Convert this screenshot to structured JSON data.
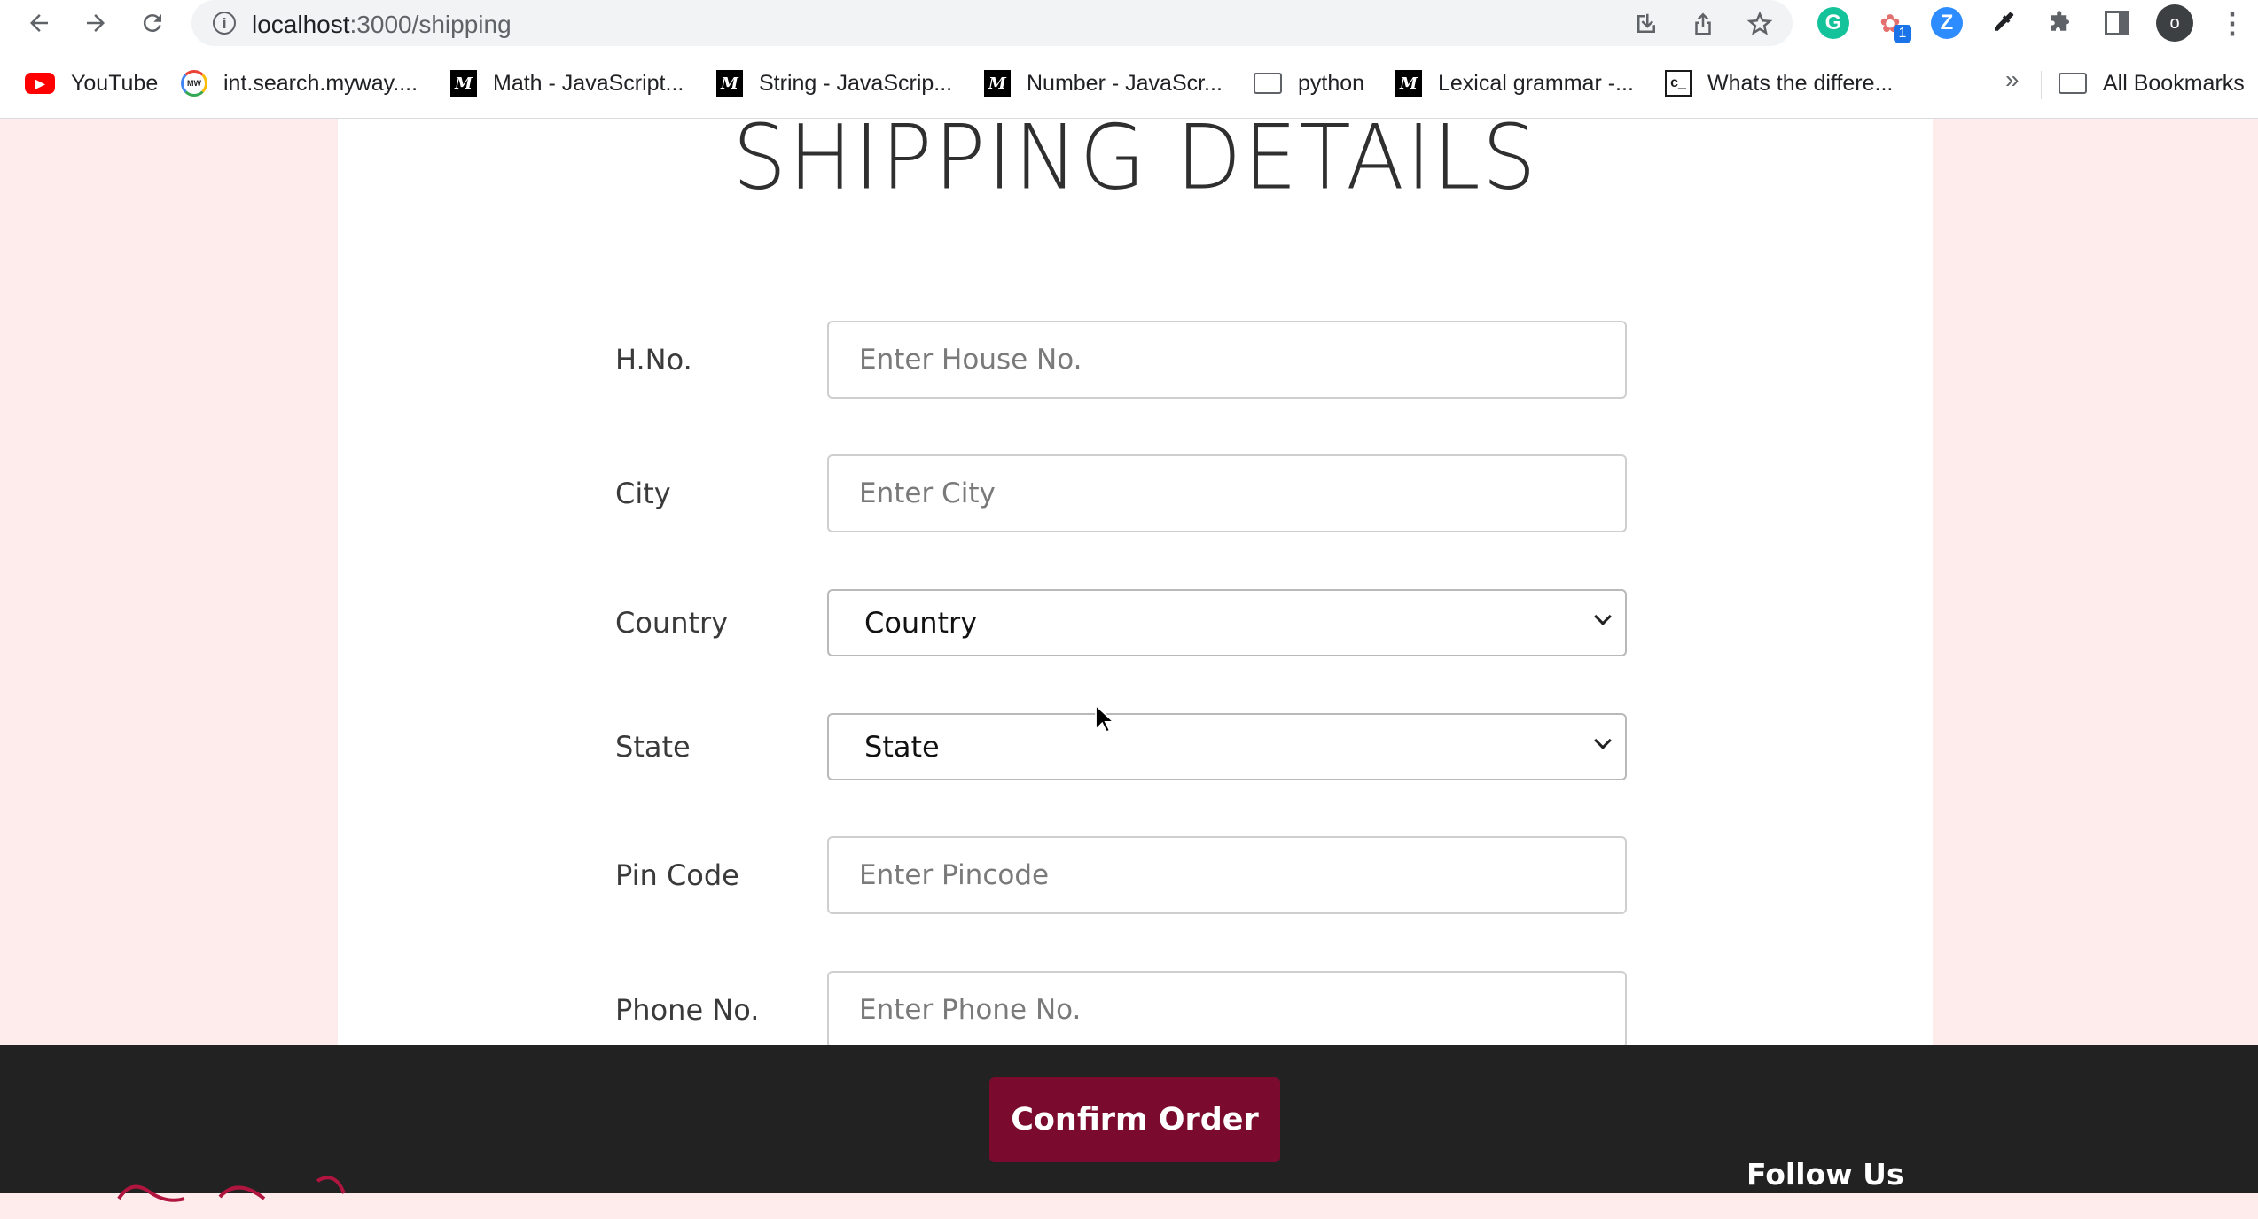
{
  "browser": {
    "url_host": "localhost",
    "url_path": ":3000/shipping",
    "avatar_letter": "o",
    "extension_badge": "1"
  },
  "bookmarks": [
    {
      "label": "YouTube",
      "icon": "youtube-icon"
    },
    {
      "label": "int.search.myway....",
      "icon": "myway-icon"
    },
    {
      "label": "Math - JavaScript...",
      "icon": "mdn-icon"
    },
    {
      "label": "String - JavaScrip...",
      "icon": "mdn-icon"
    },
    {
      "label": "Number - JavaScr...",
      "icon": "mdn-icon"
    },
    {
      "label": "python",
      "icon": "folder-icon"
    },
    {
      "label": "Lexical grammar -...",
      "icon": "mdn-icon"
    },
    {
      "label": "Whats the differe...",
      "icon": "codeproject-icon"
    }
  ],
  "bookmarks_more": "»",
  "all_bookmarks": "All Bookmarks",
  "page": {
    "title": "SHIPPING DETAILS",
    "fields": {
      "hno": {
        "label": "H.No.",
        "placeholder": "Enter House No."
      },
      "city": {
        "label": "City",
        "placeholder": "Enter City"
      },
      "country": {
        "label": "Country",
        "selected": "Country"
      },
      "state": {
        "label": "State",
        "selected": "State"
      },
      "pincode": {
        "label": "Pin Code",
        "placeholder": "Enter Pincode"
      },
      "phone": {
        "label": "Phone No.",
        "placeholder": "Enter Phone No."
      }
    },
    "confirm_label": "Confirm Order"
  },
  "footer": {
    "follow_us": "Follow Us"
  },
  "colors": {
    "page_bg": "#fdeceb",
    "footer_bg": "#222222",
    "confirm_bg": "#7a0b2e"
  }
}
